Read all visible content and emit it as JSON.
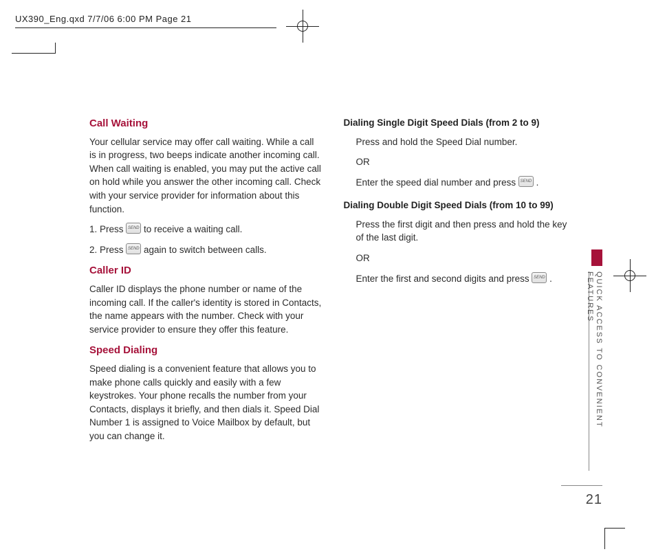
{
  "header": {
    "stamp": "UX390_Eng.qxd  7/7/06  6:00 PM  Page 21"
  },
  "left": {
    "h1": "Call Waiting",
    "p1": "Your cellular service may offer call waiting. While a call is in progress, two beeps indicate another incoming call. When call waiting is enabled, you may put the active call on hold while you answer the other incoming call. Check with your service provider for information about this function.",
    "step1a": "1. Press ",
    "step1b": " to receive a waiting call.",
    "step2a": "2. Press ",
    "step2b": " again to switch between calls.",
    "h2": "Caller ID",
    "p2": "Caller ID displays the phone number or name of the incoming call. If the caller's identity is stored in Contacts, the name appears with the number. Check with your service provider to ensure they offer this feature.",
    "h3": "Speed Dialing",
    "p3": "Speed dialing is a convenient feature that allows you to make phone calls quickly and easily with a few keystrokes. Your phone recalls the number from your Contacts, displays it briefly, and then dials it. Speed Dial Number 1 is assigned to Voice Mailbox by default, but you can change it."
  },
  "right": {
    "sh1": "Dialing Single Digit Speed Dials (from 2 to 9)",
    "r1": "Press and hold the Speed Dial number.",
    "or": "OR",
    "r2a": "Enter the speed dial number and press ",
    "r2b": " .",
    "sh2": "Dialing Double Digit Speed Dials (from 10 to 99)",
    "r3": "Press the first digit and then press and hold the key of the last digit.",
    "r4a": "Enter the first and second digits and press ",
    "r4b": " ."
  },
  "side": {
    "label": "QUICK ACCESS TO CONVENIENT\nFEATURES"
  },
  "page_number": "21",
  "key_label": "SEND"
}
